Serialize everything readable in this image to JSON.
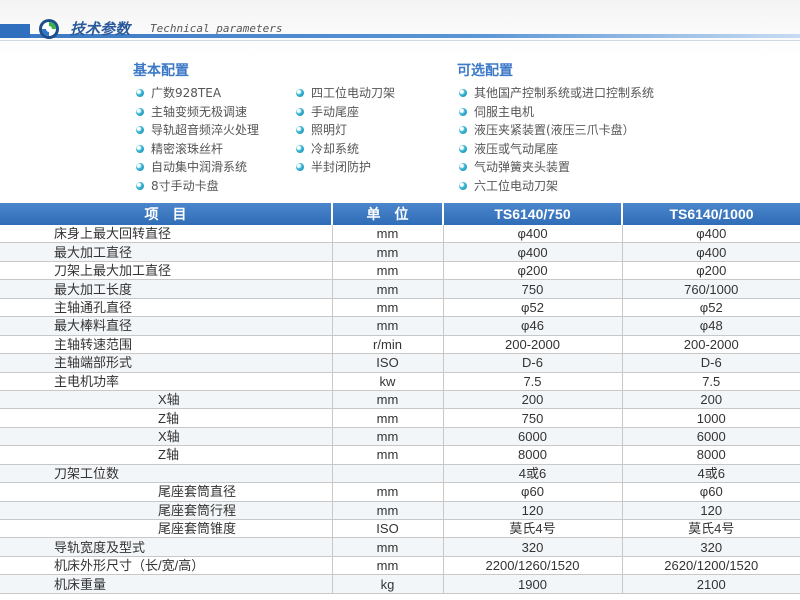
{
  "header": {
    "title_cn": "技术参数",
    "title_en": "Technical parameters",
    "logo_icon": "circular-arrow-logo-icon",
    "accent_color": "#2f6fbd"
  },
  "config": {
    "basic": {
      "title": "基本配置",
      "col1": [
        "广数928TEA",
        "主轴变频无极调速",
        "导轨超音频淬火处理",
        "精密滚珠丝杆",
        "自动集中润滑系统",
        "8寸手动卡盘"
      ],
      "col2": [
        "四工位电动刀架",
        "手动尾座",
        "照明灯",
        "冷却系统",
        "半封闭防护"
      ]
    },
    "optional": {
      "title": "可选配置",
      "items": [
        "其他国产控制系统或进口控制系统",
        "伺服主电机",
        "液压夹紧装置(液压三爪卡盘）",
        "液压或气动尾座",
        "气动弹簧夹头装置",
        "六工位电动刀架"
      ]
    },
    "bullet_icon": "blue-dot-bullet-icon"
  },
  "table": {
    "headers": [
      "项　目",
      "单　位",
      "TS6140/750",
      "TS6140/1000"
    ],
    "header_color": "#3a78c2",
    "rows": [
      {
        "item": "床身上最大回转直径",
        "unit": "mm",
        "v1": "φ400",
        "v2": "φ400",
        "sub": false
      },
      {
        "item": "最大加工直径",
        "unit": "mm",
        "v1": "φ400",
        "v2": "φ400",
        "sub": false
      },
      {
        "item": "刀架上最大加工直径",
        "unit": "mm",
        "v1": "φ200",
        "v2": "φ200",
        "sub": false
      },
      {
        "item": "最大加工长度",
        "unit": "mm",
        "v1": "750",
        "v2": "760/1000",
        "sub": false
      },
      {
        "item": "主轴通孔直径",
        "unit": "mm",
        "v1": "φ52",
        "v2": "φ52",
        "sub": false
      },
      {
        "item": "最大棒料直径",
        "unit": "mm",
        "v1": "φ46",
        "v2": "φ48",
        "sub": false
      },
      {
        "item": "主轴转速范围",
        "unit": "r/min",
        "v1": "200-2000",
        "v2": "200-2000",
        "sub": false
      },
      {
        "item": "主轴端部形式",
        "unit": "ISO",
        "v1": "D-6",
        "v2": "D-6",
        "sub": false
      },
      {
        "item": "主电机功率",
        "unit": "kw",
        "v1": "7.5",
        "v2": "7.5",
        "sub": false
      },
      {
        "item": "X轴",
        "unit": "mm",
        "v1": "200",
        "v2": "200",
        "sub": true
      },
      {
        "item": "Z轴",
        "unit": "mm",
        "v1": "750",
        "v2": "1000",
        "sub": true
      },
      {
        "item": "X轴",
        "unit": "mm",
        "v1": "6000",
        "v2": "6000",
        "sub": true
      },
      {
        "item": "Z轴",
        "unit": "mm",
        "v1": "8000",
        "v2": "8000",
        "sub": true
      },
      {
        "item": "刀架工位数",
        "unit": "",
        "v1": "4或6",
        "v2": "4或6",
        "sub": false
      },
      {
        "item": "尾座套筒直径",
        "unit": "mm",
        "v1": "φ60",
        "v2": "φ60",
        "sub": true
      },
      {
        "item": "尾座套筒行程",
        "unit": "mm",
        "v1": "120",
        "v2": "120",
        "sub": true
      },
      {
        "item": "尾座套筒锥度",
        "unit": "ISO",
        "v1": "莫氏4号",
        "v2": "莫氏4号",
        "sub": true
      },
      {
        "item": "导轨宽度及型式",
        "unit": "mm",
        "v1": "320",
        "v2": "320",
        "sub": false
      },
      {
        "item": "机床外形尺寸（长/宽/高）",
        "unit": "mm",
        "v1": "2200/1260/1520",
        "v2": "2620/1200/1520",
        "sub": false
      },
      {
        "item": "机床重量",
        "unit": "kg",
        "v1": "1900",
        "v2": "2100",
        "sub": false
      }
    ]
  }
}
